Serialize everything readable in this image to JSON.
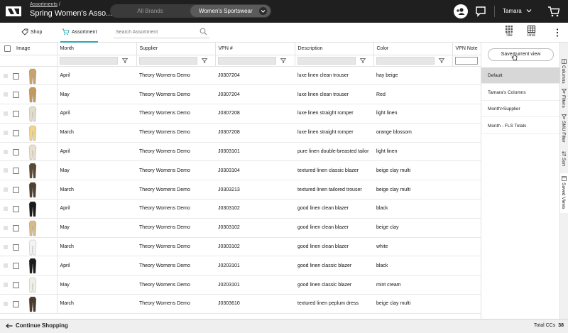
{
  "topbar": {
    "breadcrumb": "Assortments",
    "breadcrumb_sep": "/",
    "title": "Spring Women's Asso...",
    "brand_options": [
      "All Brands",
      "Women's Sportswear"
    ],
    "user_name": "Tamara"
  },
  "toolbar": {
    "tabs": [
      {
        "label": "Shop",
        "icon": "tag-icon"
      },
      {
        "label": "Assortment",
        "icon": "cart-icon"
      }
    ],
    "search_placeholder": "Search Assortment",
    "view_buttons": [
      {
        "label": "Tile",
        "icon": "tile-icon"
      },
      {
        "label": "Grid",
        "icon": "grid-icon"
      }
    ]
  },
  "grid": {
    "columns": [
      "Image",
      "Month",
      "Supplier",
      "VPN #",
      "Description",
      "Color",
      "VPN Note"
    ],
    "rows": [
      {
        "month": "April",
        "supplier": "Theory Womens Demo",
        "vpn": "J0307204",
        "description": "luxe linen clean trouser",
        "color": "hay beige",
        "thumb": "#c9a36a"
      },
      {
        "month": "May",
        "supplier": "Theory Womens Demo",
        "vpn": "J0307204",
        "description": "luxe linen clean trouser",
        "color": "Red",
        "thumb": "#c29a5e"
      },
      {
        "month": "April",
        "supplier": "Theory Womens Demo",
        "vpn": "J0307208",
        "description": "luxe linen straight romper",
        "color": "light linen",
        "thumb": "#e2dccd"
      },
      {
        "month": "March",
        "supplier": "Theory Womens Demo",
        "vpn": "J0307208",
        "description": "luxe linen straight romper",
        "color": "orange blossom",
        "thumb": "#f0d48c"
      },
      {
        "month": "April",
        "supplier": "Theory Womens Demo",
        "vpn": "J0303101",
        "description": "pure linen double-breasted tailor",
        "color": "light linen",
        "thumb": "#e8dfcc"
      },
      {
        "month": "May",
        "supplier": "Theory Womens Demo",
        "vpn": "J0303104",
        "description": "textured linen classic blazer",
        "color": "beige clay multi",
        "thumb": "#5a4a34"
      },
      {
        "month": "March",
        "supplier": "Theory Womens Demo",
        "vpn": "J0303213",
        "description": "textured linen tailored trouser",
        "color": "beige clay multi",
        "thumb": "#4f4030"
      },
      {
        "month": "April",
        "supplier": "Theory Womens Demo",
        "vpn": "J0303102",
        "description": "good linen clean blazer",
        "color": "black",
        "thumb": "#1a1a1a"
      },
      {
        "month": "May",
        "supplier": "Theory Womens Demo",
        "vpn": "J0303102",
        "description": "good linen clean blazer",
        "color": "beige clay",
        "thumb": "#d7b98a"
      },
      {
        "month": "March",
        "supplier": "Theory Womens Demo",
        "vpn": "J0303102",
        "description": "good linen clean blazer",
        "color": "white",
        "thumb": "#f3f3f3"
      },
      {
        "month": "April",
        "supplier": "Theory Womens Demo",
        "vpn": "J0203101",
        "description": "good linen classic blazer",
        "color": "black",
        "thumb": "#1c1c1c"
      },
      {
        "month": "May",
        "supplier": "Theory Womens Demo",
        "vpn": "J0203101",
        "description": "good linen classic blazer",
        "color": "mint cream",
        "thumb": "#efefe6"
      },
      {
        "month": "March",
        "supplier": "Theory Womens Demo",
        "vpn": "J0303610",
        "description": "textured linen peplum dress",
        "color": "beige clay multi",
        "thumb": "#4a3c2c"
      }
    ]
  },
  "views_panel": {
    "save_button": "Save current view",
    "items": [
      "Default",
      "Tamara's Columns",
      "Month>Supplier",
      "Month - FLS Totals"
    ],
    "selected_index": 0
  },
  "side_tabs": [
    "Columns",
    "Filters",
    "SMU Filter",
    "Sort",
    "Saved Views"
  ],
  "bottombar": {
    "continue_label": "Continue Shopping",
    "total_label": "Total CCs",
    "total_value": "38"
  },
  "colors": {
    "topbar_bg": "#1f1f1f",
    "accent": "#2ba7b5"
  }
}
